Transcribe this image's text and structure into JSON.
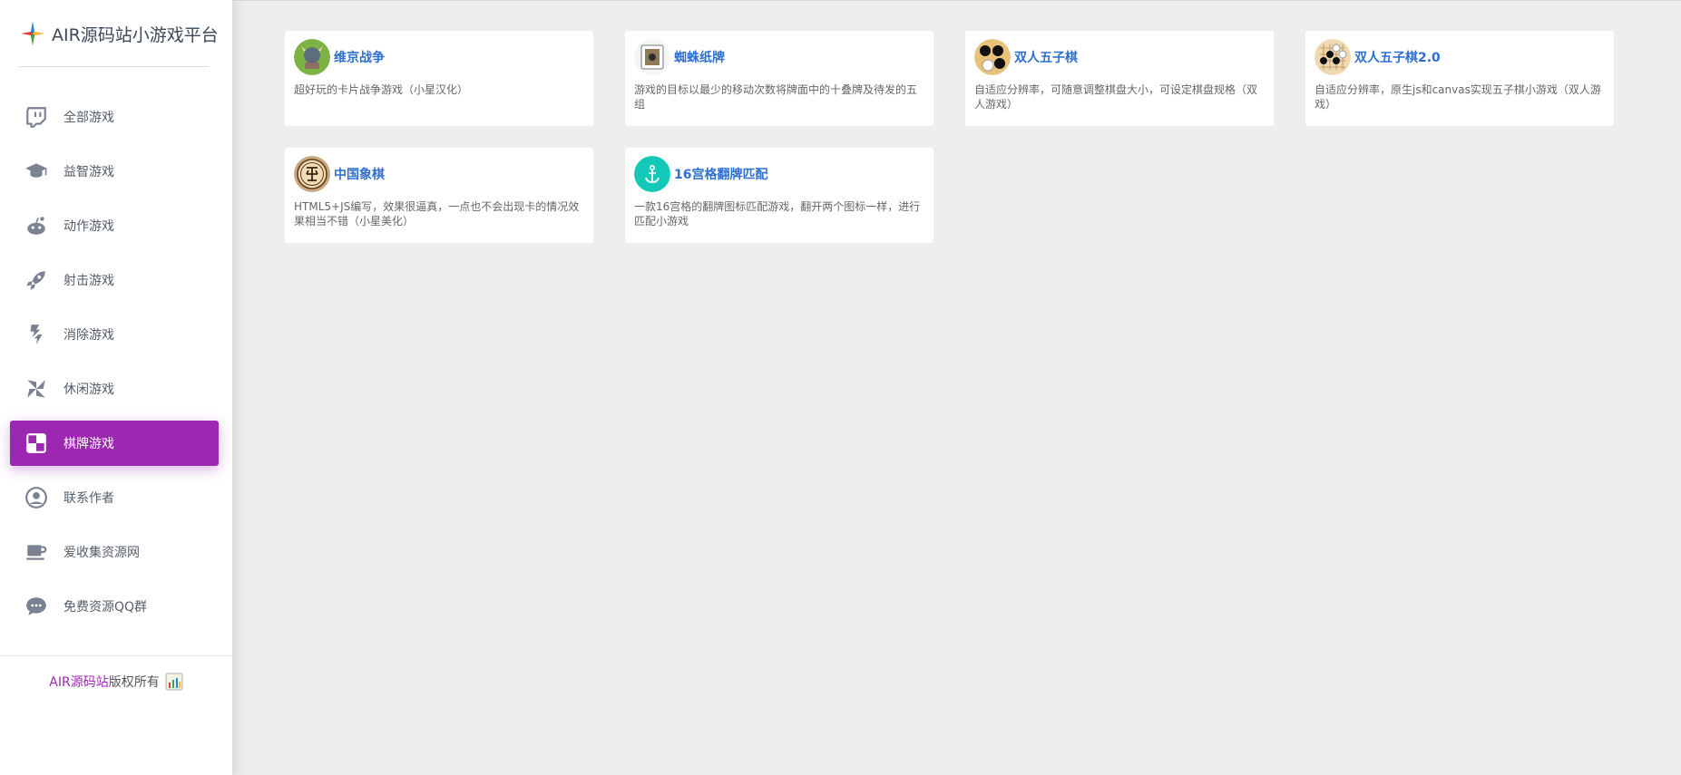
{
  "sidebar": {
    "title": "AIR源码站小游戏平台",
    "items": [
      {
        "label": "全部游戏",
        "icon": "twitch-icon"
      },
      {
        "label": "益智游戏",
        "icon": "graduation-cap-icon"
      },
      {
        "label": "动作游戏",
        "icon": "reddit-robot-icon"
      },
      {
        "label": "射击游戏",
        "icon": "rocket-icon"
      },
      {
        "label": "消除游戏",
        "icon": "puzzle-icon"
      },
      {
        "label": "休闲游戏",
        "icon": "pinwheel-icon"
      },
      {
        "label": "棋牌游戏",
        "icon": "checkerboard-icon",
        "active": true
      },
      {
        "label": "联系作者",
        "icon": "user-circle-icon"
      },
      {
        "label": "爱收集资源网",
        "icon": "coffee-cup-icon"
      },
      {
        "label": "免费资源QQ群",
        "icon": "chat-bubble-icon"
      }
    ],
    "footer": {
      "brand": "AIR源码站",
      "suffix": "版权所有"
    }
  },
  "games": [
    {
      "title": "维京战争",
      "desc": "超好玩的卡片战争游戏（小星汉化）",
      "thumb": "viking-thumb"
    },
    {
      "title": "蜘蛛纸牌",
      "desc": "游戏的目标以最少的移动次数将牌面中的十叠牌及待发的五组",
      "thumb": "spider-card-thumb"
    },
    {
      "title": "双人五子棋",
      "desc": "自适应分辨率，可随意调整棋盘大小，可设定棋盘规格（双人游戏）",
      "thumb": "gomoku-thumb"
    },
    {
      "title": "双人五子棋2.0",
      "desc": "自适应分辨率，原生js和canvas实现五子棋小游戏（双人游戏）",
      "thumb": "gomoku2-thumb"
    },
    {
      "title": "中国象棋",
      "desc": "HTML5+JS编写，效果很逼真，一点也不会出现卡的情况效果相当不错（小星美化）",
      "thumb": "xiangqi-thumb"
    },
    {
      "title": "16宫格翻牌匹配",
      "desc": "一款16宫格的翻牌图标匹配游戏，翻开两个图标一样，进行匹配小游戏",
      "thumb": "anchor-thumb"
    }
  ],
  "colors": {
    "accent": "#9c27b0",
    "link": "#2f6fd0",
    "background": "#eeeeee"
  }
}
